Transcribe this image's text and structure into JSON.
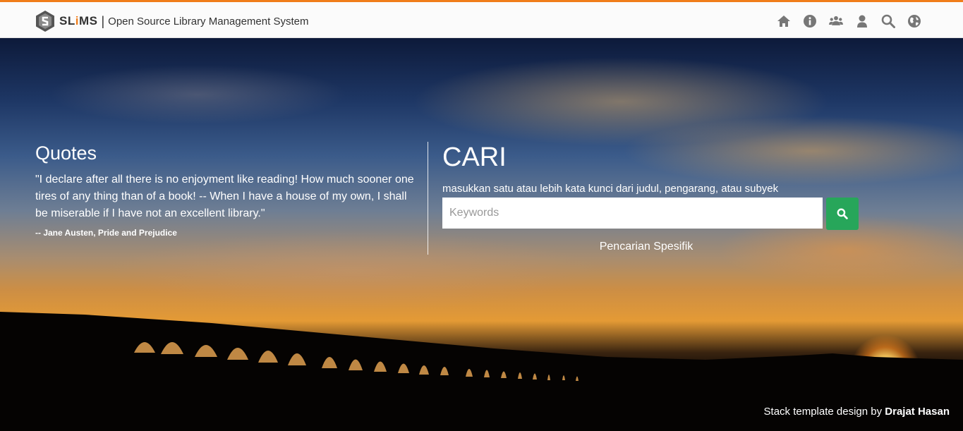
{
  "brand": {
    "name_part1": "SL",
    "name_i": "i",
    "name_part2": "MS",
    "separator": "|",
    "tagline": "Open Source Library Management System"
  },
  "nav": {
    "icons": [
      "home-icon",
      "info-icon",
      "users-icon",
      "user-icon",
      "search-icon",
      "globe-icon"
    ],
    "icon_color": "#777777"
  },
  "quotes": {
    "title": "Quotes",
    "text": "\"I declare after all there is no enjoyment like reading! How much sooner one tires of any thing than of a book! -- When I have a house of my own, I shall be miserable if I have not an excellent library.\"",
    "author": "-- Jane Austen, Pride and Prejudice"
  },
  "search": {
    "title": "CARI",
    "hint": "masukkan satu atau lebih kata kunci dari judul, pengarang, atau subyek",
    "placeholder": "Keywords",
    "button_icon": "search-icon",
    "advanced_label": "Pencarian Spesifik"
  },
  "footer": {
    "credit_prefix": "Stack template design by",
    "credit_author": "Drajat Hasan"
  },
  "colors": {
    "accent": "#f07d1a",
    "search_button": "#27a65a"
  }
}
